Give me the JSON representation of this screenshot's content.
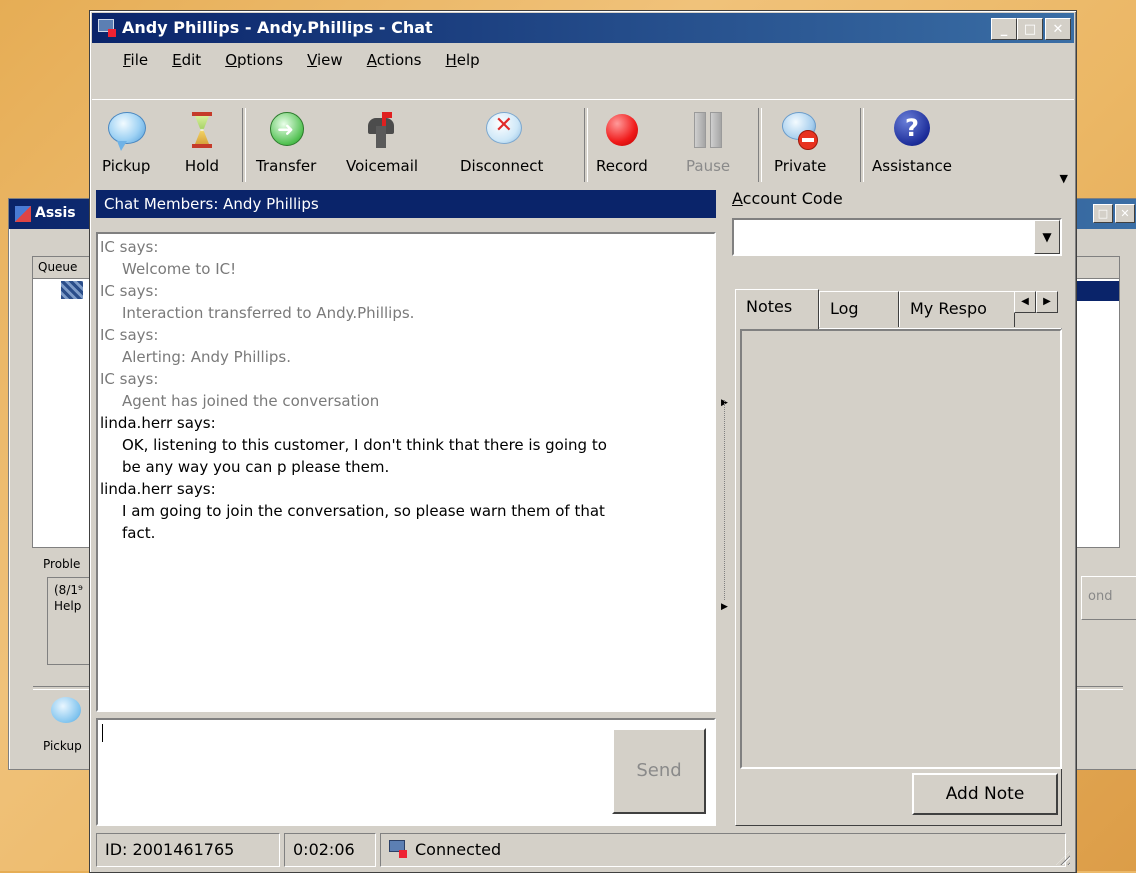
{
  "background_window": {
    "title": "Assis",
    "queue_header": "Queue",
    "problem_label": "Proble",
    "problem_lines": [
      "(8/1⁹",
      "Help"
    ],
    "pickup_label": "Pickup",
    "send_label": "ond"
  },
  "window": {
    "title": "Andy Phillips - Andy.Phillips - Chat"
  },
  "menu": [
    {
      "label": "File",
      "key": "F",
      "rest": "ile"
    },
    {
      "label": "Edit",
      "key": "E",
      "rest": "dit"
    },
    {
      "label": "Options",
      "key": "O",
      "rest": "ptions"
    },
    {
      "label": "View",
      "key": "V",
      "rest": "iew"
    },
    {
      "label": "Actions",
      "key": "A",
      "rest": "ctions"
    },
    {
      "label": "Help",
      "key": "H",
      "rest": "elp"
    }
  ],
  "toolbar": {
    "pickup": "Pickup",
    "hold": "Hold",
    "transfer": "Transfer",
    "voicemail": "Voicemail",
    "disconnect": "Disconnect",
    "record": "Record",
    "pause": "Pause",
    "private": "Private",
    "assistance": "Assistance"
  },
  "chat": {
    "members_label": "Chat Members: Andy Phillips",
    "messages": [
      {
        "who": "IC says:",
        "lines": [
          "Welcome to IC!"
        ],
        "type": "system"
      },
      {
        "who": "IC says:",
        "lines": [
          "Interaction transferred to Andy.Phillips."
        ],
        "type": "system"
      },
      {
        "who": "IC says:",
        "lines": [
          "Alerting: Andy Phillips."
        ],
        "type": "system"
      },
      {
        "who": "IC says:",
        "lines": [
          "Agent has joined the conversation"
        ],
        "type": "system"
      },
      {
        "who": "linda.herr says:",
        "lines": [
          "OK, listening to this customer, I don't think that there is going to",
          "be any way you can p please them."
        ],
        "type": "user"
      },
      {
        "who": "linda.herr says:",
        "lines": [
          "I am going to join the conversation, so please warn them of that",
          "fact."
        ],
        "type": "user"
      }
    ],
    "input_value": "",
    "send_label": "Send"
  },
  "account": {
    "label_key": "A",
    "label_rest": "ccount Code",
    "value": ""
  },
  "tabs": [
    "Notes",
    "Log",
    "My Respo"
  ],
  "notes": {
    "add_note_label": "Add Note"
  },
  "status": {
    "id": "ID: 2001461765",
    "duration": "0:02:06",
    "state": "Connected"
  }
}
